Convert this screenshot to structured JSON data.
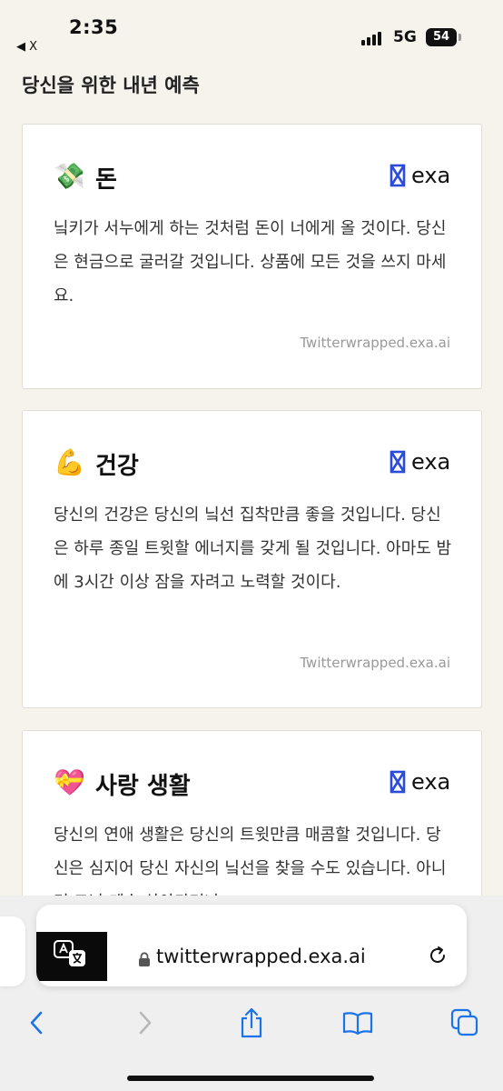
{
  "status_bar": {
    "time": "2:35",
    "back_app": "◀ X",
    "network": "5G",
    "battery": "54"
  },
  "page": {
    "title": "당신을 위한 내년 예측"
  },
  "cards": [
    {
      "emoji": "💸",
      "title": "돈",
      "brand": "exa",
      "body": "닠키가 서누에게 하는 것처럼 돈이 너에게 올 것이다. 당신은 현금으로 굴러갈 것입니다. 상품에 모든 것을 쓰지 마세요.",
      "footer": "Twitterwrapped.exa.ai"
    },
    {
      "emoji": "💪",
      "title": "건강",
      "brand": "exa",
      "body": "당신의 건강은 당신의 닠선 집착만큼 좋을 것입니다. 당신은 하루 종일 트윗할 에너지를 갖게 될 것입니다. 아마도 밤에 3시간 이상 잠을 자려고 노력할 것이다.",
      "footer": "Twitterwrapped.exa.ai"
    },
    {
      "emoji": "💝",
      "title": "사랑 생활",
      "brand": "exa",
      "body": "당신의 연애 생활은 당신의 트윗만큼 매콤할 것입니다. 당신은 심지어 당신 자신의 닠선을 찾을 수도 있습니다. 아니면 그냥 계속 살아가거나.",
      "footer": ""
    }
  ],
  "browser": {
    "url": "twitterwrapped.exa.ai"
  },
  "colors": {
    "background": "#f6f3ec",
    "exa_logo": "#2b4bd9",
    "footer_text": "#999999",
    "ios_blue": "#1a73e8"
  }
}
